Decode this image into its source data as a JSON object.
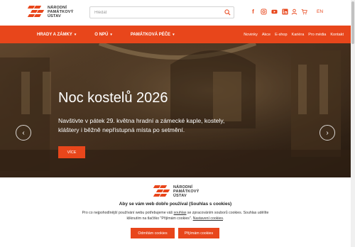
{
  "header": {
    "logo_lines": [
      "NÁRODNÍ",
      "PAMÁTKOVÝ",
      "ÚSTAV"
    ],
    "search_placeholder": "Hledat",
    "socials": [
      "facebook-icon",
      "instagram-icon",
      "youtube-icon",
      "linkedin-icon"
    ],
    "language": "EN"
  },
  "nav": {
    "left": [
      {
        "label": "HRADY A ZÁMKY"
      },
      {
        "label": "O NPÚ"
      },
      {
        "label": "PAMÁTKOVÁ PÉČE"
      }
    ],
    "right": [
      "Novinky",
      "Akce",
      "E-shop",
      "Kariéra",
      "Pro média",
      "Kontakt"
    ]
  },
  "hero": {
    "title": "Noc kostelů 2026",
    "text": "Navštivte v pátek 29. května hradní a zámecké kaple, kostely, kláštery i běžně nepřístupná místa po setmění.",
    "button": "VÍCE"
  },
  "cookie": {
    "logo_lines": [
      "NÁRODNÍ",
      "PAMÁTKOVÝ",
      "ÚSTAV"
    ],
    "title": "Aby se vám web dobře používal (Souhlas s cookies)",
    "text_part1": "Pro co nejpohodlnější používání webu potřebujeme váš ",
    "text_link1": "souhlas",
    "text_part2": " se zpracováním souborů cookies. Souhlas udělíte kliknutím na tlačítko \"Přijímám cookies\". ",
    "text_link2": "Nastavení cookies",
    "text_part3": ".",
    "reject_label": "Odmítám cookies",
    "accept_label": "Přijímám cookies"
  },
  "colors": {
    "accent": "#e8461b",
    "hero_bg": "#3a2a1c"
  }
}
